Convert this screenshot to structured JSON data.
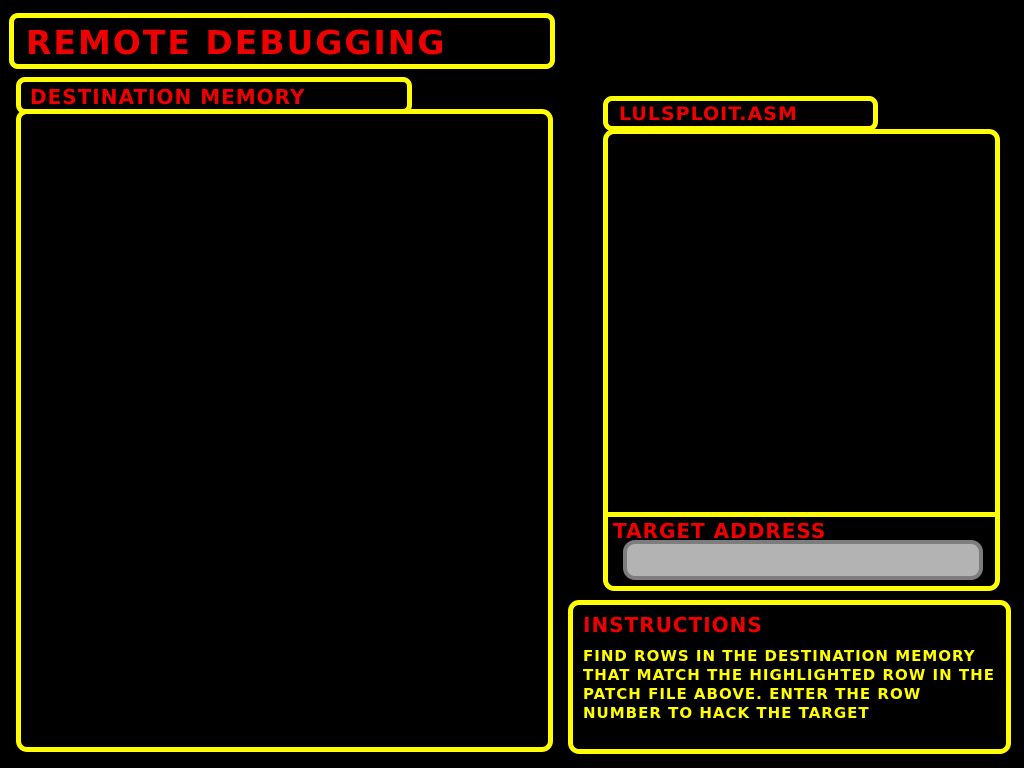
{
  "header": {
    "title": "REMOTE DEBUGGING"
  },
  "destination_memory": {
    "label": "DESTINATION MEMORY"
  },
  "patch_file": {
    "label": "LULSPLOIT.ASM"
  },
  "target": {
    "label": "TARGET ADDRESS",
    "value": "",
    "placeholder": ""
  },
  "instructions": {
    "heading": "INSTRUCTIONS",
    "text": "FIND ROWS IN THE DESTINATION MEMORY THAT MATCH THE HIGHLIGHTED ROW IN THE PATCH FILE ABOVE. ENTER THE ROW NUMBER TO HACK THE TARGET"
  },
  "colors": {
    "border": "#ffff00",
    "heading_text": "#ee0000",
    "body_text": "#ffff00",
    "background": "#000000",
    "input_fill": "#b3b3b3",
    "input_border": "#7d7d7d"
  }
}
